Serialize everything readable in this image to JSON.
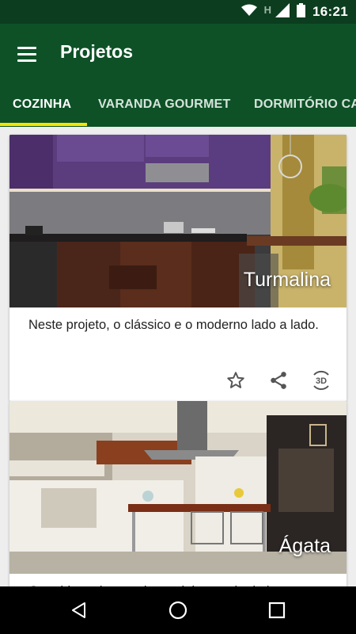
{
  "status_bar": {
    "time": "16:21",
    "network_label": "H"
  },
  "app_bar": {
    "title": "Projetos"
  },
  "tabs": [
    {
      "label": "COZINHA",
      "active": true
    },
    {
      "label": "VARANDA GOURMET",
      "active": false
    },
    {
      "label": "DORMITÓRIO CASAL",
      "active": false
    }
  ],
  "projects": [
    {
      "name": "Turmalina",
      "description": "Neste projeto, o clássico e o moderno lado a lado.",
      "badge_3d": "3D"
    },
    {
      "name": "Ágata",
      "description": "O ambiente integrado, cozinha e sala de jantar"
    }
  ],
  "colors": {
    "status_bar": "#0c3d1f",
    "app_bar": "#0e5127",
    "tab_indicator": "#f2e600"
  }
}
